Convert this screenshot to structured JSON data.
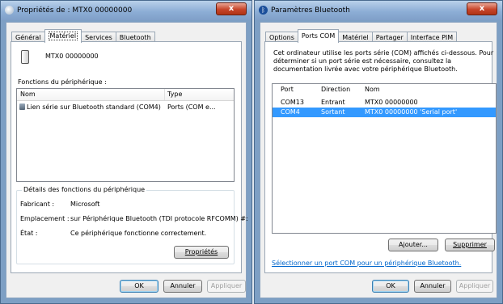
{
  "left_window": {
    "title": "Propriétés de : MTX0 00000000",
    "close_label": "x",
    "tabs": [
      {
        "label": "Général"
      },
      {
        "label": "Matériel"
      },
      {
        "label": "Services"
      },
      {
        "label": "Bluetooth"
      }
    ],
    "device_name": "MTX0 00000000",
    "functions_label": "Fonctions du périphérique :",
    "table": {
      "col_name": "Nom",
      "col_type": "Type",
      "rows": [
        {
          "name": "Lien série sur Bluetooth standard (COM4)",
          "type": "Ports (COM e..."
        }
      ]
    },
    "details": {
      "title": "Détails des fonctions du périphérique",
      "manufacturer_label": "Fabricant :",
      "manufacturer_value": "Microsoft",
      "location_label": "Emplacement :",
      "location_value": "sur Périphérique Bluetooth (TDI protocole RFCOMM) #:",
      "state_label": "État :",
      "state_value": "Ce périphérique fonctionne correctement."
    },
    "properties_button": "Propriétés",
    "buttons": {
      "ok": "OK",
      "cancel": "Annuler",
      "apply": "Appliquer"
    }
  },
  "right_window": {
    "title": "Paramètres Bluetooth",
    "close_label": "x",
    "tabs": [
      {
        "label": "Options"
      },
      {
        "label": "Ports COM"
      },
      {
        "label": "Matériel"
      },
      {
        "label": "Partager"
      },
      {
        "label": "Interface PIM"
      }
    ],
    "description": "Cet ordinateur utilise les ports série (COM) affichés ci-dessous. Pour déterminer si un port série est nécessaire, consultez la documentation livrée avec votre périphérique Bluetooth.",
    "table": {
      "col_port": "Port",
      "col_direction": "Direction",
      "col_name": "Nom",
      "rows": [
        {
          "port": "COM13",
          "direction": "Entrant",
          "name": "MTX0 00000000"
        },
        {
          "port": "COM4",
          "direction": "Sortant",
          "name": "MTX0 00000000 'Serial port'"
        }
      ]
    },
    "add_button": "Ajouter...",
    "remove_button": "Supprimer",
    "link": "Sélectionner un port COM pour un périphérique Bluetooth.",
    "buttons": {
      "ok": "OK",
      "cancel": "Annuler",
      "apply": "Appliquer"
    }
  },
  "colors": {
    "selection": "#3399ff",
    "link": "#0066cc",
    "title_bar": "#8daed6",
    "close_button": "#c7442a"
  }
}
